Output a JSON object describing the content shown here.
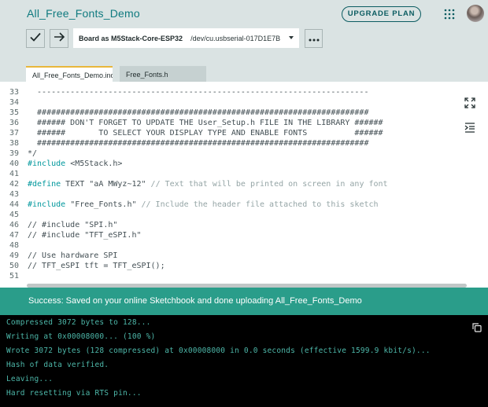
{
  "header": {
    "sketch_title": "All_Free_Fonts_Demo",
    "upgrade_label": "UPGRADE PLAN",
    "apps_icon": "grid-dots-icon",
    "avatar": "user-avatar"
  },
  "toolbar": {
    "verify_icon": "checkmark-icon",
    "upload_icon": "arrow-right-icon",
    "board_label": "Board as M5Stack-Core-ESP32",
    "port_label": "/dev/cu.usbserial-017D1E7B",
    "more_icon": "ellipsis-icon"
  },
  "tabs": [
    {
      "label": "All_Free_Fonts_Demo.ino",
      "active": true
    },
    {
      "label": "Free_Fonts.h",
      "active": false
    }
  ],
  "editor": {
    "lines": [
      {
        "num": "33",
        "text": "  ----------------------------------------------------------------------"
      },
      {
        "num": "34",
        "text": ""
      },
      {
        "num": "35",
        "text": "  ######################################################################"
      },
      {
        "num": "36",
        "text": "  ###### DON'T FORGET TO UPDATE THE User_Setup.h FILE IN THE LIBRARY ######"
      },
      {
        "num": "37",
        "text": "  ######       TO SELECT YOUR DISPLAY TYPE AND ENABLE FONTS          ######"
      },
      {
        "num": "38",
        "text": "  ######################################################################"
      },
      {
        "num": "39",
        "text": "*/"
      },
      {
        "num": "40",
        "text": "#include <M5Stack.h>"
      },
      {
        "num": "41",
        "text": ""
      },
      {
        "num": "42",
        "text": "#define TEXT \"aA MWyz~12\" // Text that will be printed on screen in any font"
      },
      {
        "num": "43",
        "text": ""
      },
      {
        "num": "44",
        "text": "#include \"Free_Fonts.h\" // Include the header file attached to this sketch"
      },
      {
        "num": "45",
        "text": ""
      },
      {
        "num": "46",
        "text": "// #include \"SPI.h\""
      },
      {
        "num": "47",
        "text": "// #include \"TFT_eSPI.h\""
      },
      {
        "num": "48",
        "text": ""
      },
      {
        "num": "49",
        "text": "// Use hardware SPI"
      },
      {
        "num": "50",
        "text": "// TFT_eSPI tft = TFT_eSPI();"
      },
      {
        "num": "51",
        "text": ""
      }
    ],
    "side_icons": [
      "expand-icon",
      "indent-icon"
    ]
  },
  "status": {
    "message": "Success: Saved on your online Sketchbook and done uploading All_Free_Fonts_Demo"
  },
  "console": {
    "lines": [
      "Compressed 3072 bytes to 128...",
      "Writing at 0x00008000... (100 %)",
      "Wrote 3072 bytes (128 compressed) at 0x00008000 in 0.0 seconds (effective 1599.9 kbit/s)...",
      "Hash of data verified.",
      "Leaving...",
      "Hard resetting via RTS pin..."
    ],
    "copy_icon": "copy-icon"
  },
  "colors": {
    "accent": "#0b5c61",
    "status_bg": "#2a9d8a",
    "console_text": "#4db7a9",
    "tab_active_border": "#e8b63b"
  }
}
